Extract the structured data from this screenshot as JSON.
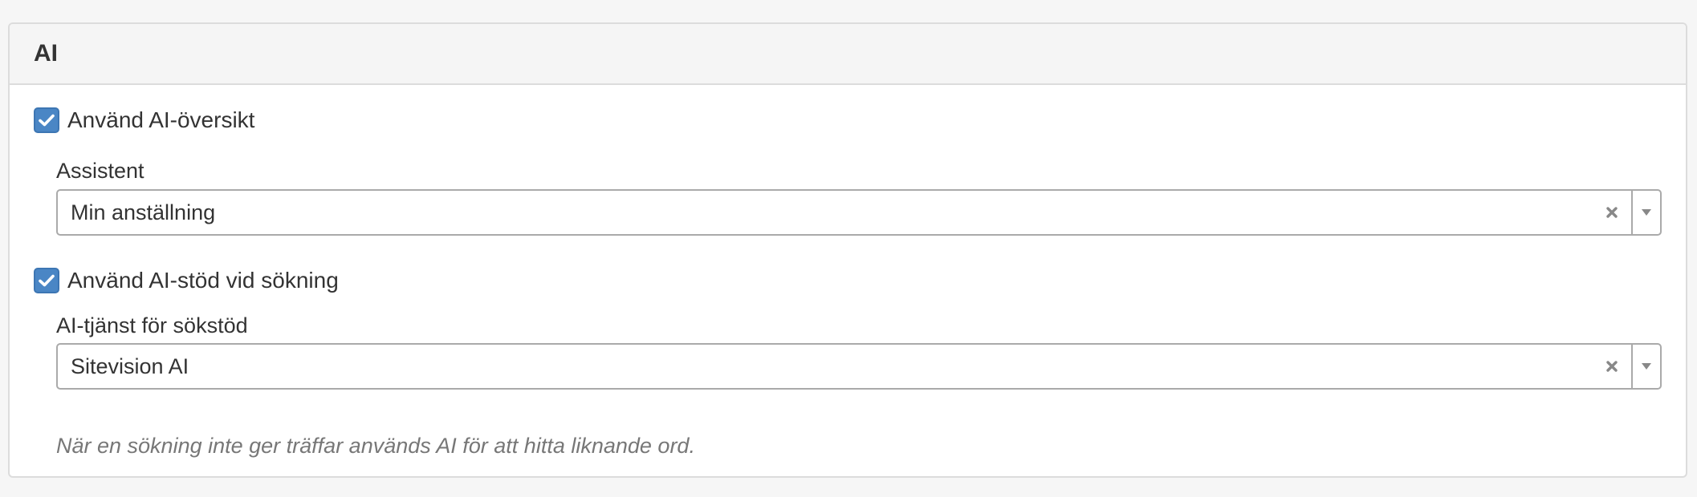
{
  "panel": {
    "title": "AI"
  },
  "overview": {
    "checkbox_label": "Använd AI-översikt",
    "checked": true,
    "assistant_label": "Assistent",
    "assistant_value": "Min anställning"
  },
  "search_support": {
    "checkbox_label": "Använd AI-stöd vid sökning",
    "checked": true,
    "service_label": "AI-tjänst för sökstöd",
    "service_value": "Sitevision AI",
    "help_text": "När en sökning inte ger träffar används AI för att hitta liknande ord."
  },
  "colors": {
    "checkbox_fill": "#4a86c5",
    "border": "#aaaaaa",
    "help_text": "#777777"
  }
}
